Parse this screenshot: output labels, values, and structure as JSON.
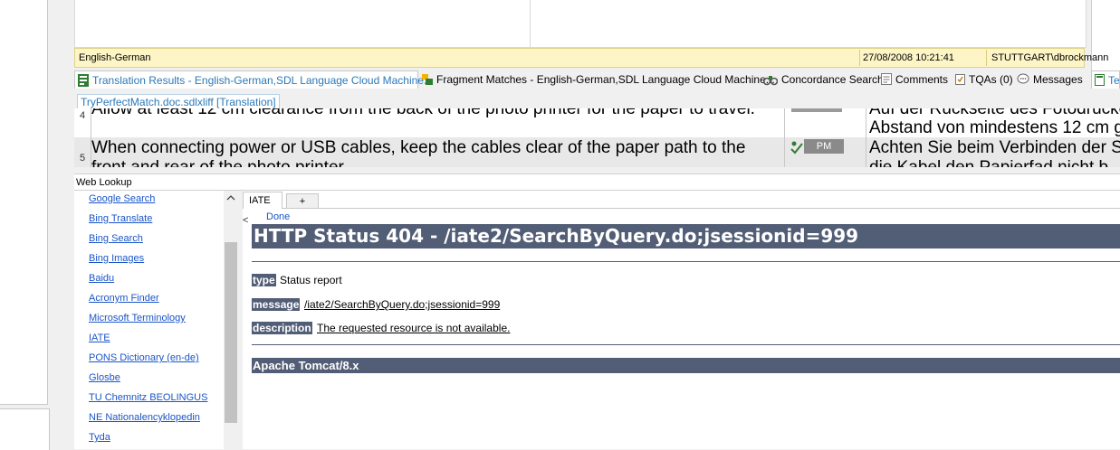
{
  "status_bar": {
    "language_pair": "English-German",
    "datetime": "27/08/2008 10:21:41",
    "user": "STUTTGART\\dbrockmann"
  },
  "tabs": [
    {
      "label": "Translation Results - English-German,SDL Language Cloud Machine...",
      "icon": "translation-results-icon",
      "active": true
    },
    {
      "label": "Fragment Matches - English-German,SDL Language Cloud Machine...",
      "icon": "fragment-matches-icon"
    },
    {
      "label": "Concordance Search",
      "icon": "concordance-icon"
    },
    {
      "label": "Comments",
      "icon": "comments-icon"
    },
    {
      "label": "TQAs (0)",
      "icon": "tqa-icon"
    },
    {
      "label": "Messages",
      "icon": "messages-icon"
    },
    {
      "label": "Te",
      "icon": "term-icon"
    }
  ],
  "document_tab": "TryPerfectMatch.doc.sdlxliff [Translation]",
  "segments": [
    {
      "num": "4",
      "source": "Allow at least 12 cm clearance from the back of the photo printer for the paper to travel.",
      "target_line1": "Auf der Rückseite des Fotodruckers",
      "target_line2": "Abstand von mindestens 12 cm g"
    },
    {
      "num": "5",
      "source": "When connecting power or USB cables, keep the cables clear of the paper path to the",
      "source_line2": "front and rear of the photo printer.",
      "status": "PM",
      "target_line1": "Achten Sie beim Verbinden der S",
      "target_line2": "die Kabel den Papierfad nicht b"
    }
  ],
  "web_lookup": {
    "title": "Web Lookup",
    "providers": [
      "Google Search",
      "Bing Translate",
      "Bing Search",
      "Bing Images",
      "Baidu",
      "Acronym Finder",
      "Microsoft Terminology",
      "IATE",
      "PONS Dictionary (en-de)",
      "Glosbe",
      "TU Chemnitz BEOLINGUS",
      "NE Nationalencyklopedin",
      "Tyda"
    ],
    "browser_tab": "IATE",
    "add_tab": "+",
    "collapse": "<",
    "done": "Done"
  },
  "error_page": {
    "title": "HTTP Status 404 - /iate2/SearchByQuery.do;jsessionid=999",
    "type_label": "type",
    "type_value": "Status report",
    "message_label": "message",
    "message_value": "/iate2/SearchByQuery.do;jsessionid=999",
    "description_label": "description",
    "description_value": "The requested resource is not available.",
    "server": "Apache Tomcat/8.x"
  },
  "colors": {
    "accent": "#2b79b8",
    "tomcat_bar": "#525d76",
    "status_bar": "#fdf5c6",
    "link": "#1a55c9"
  }
}
